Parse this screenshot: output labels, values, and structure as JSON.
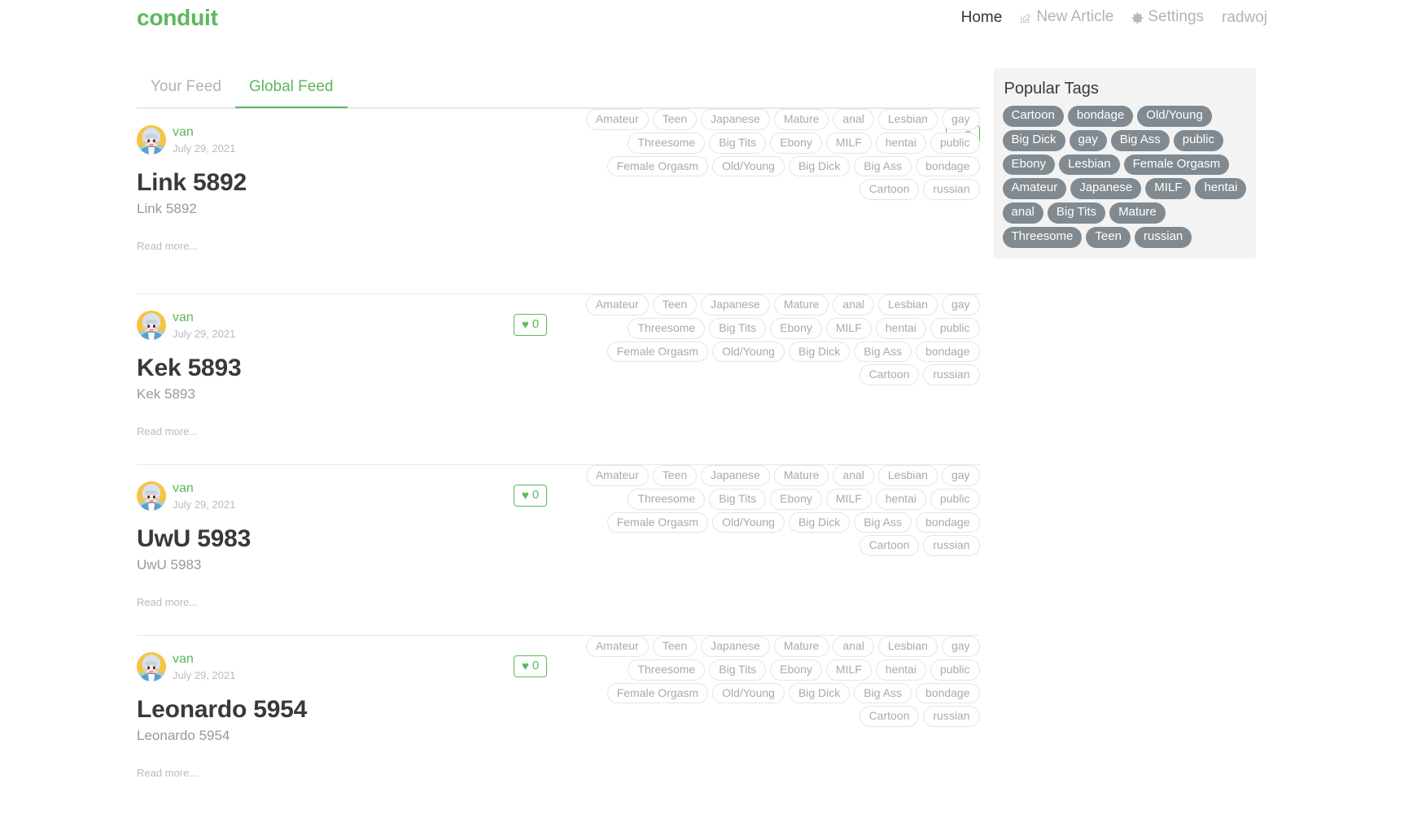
{
  "brand": "conduit",
  "nav": {
    "items": [
      {
        "label": "Home",
        "icon": null,
        "active": true
      },
      {
        "label": "New Article",
        "icon": "edit-icon",
        "active": false
      },
      {
        "label": "Settings",
        "icon": "gear-icon",
        "active": false
      },
      {
        "label": "radwoj",
        "icon": null,
        "active": false
      }
    ]
  },
  "feed_tabs": [
    {
      "label": "Your Feed",
      "active": false
    },
    {
      "label": "Global Feed",
      "active": true
    }
  ],
  "article_tags": [
    "Amateur",
    "Teen",
    "Japanese",
    "Mature",
    "anal",
    "Lesbian",
    "gay",
    "Threesome",
    "Big Tits",
    "Ebony",
    "MILF",
    "hentai",
    "public",
    "Female Orgasm",
    "Old/Young",
    "Big Dick",
    "Big Ass",
    "bondage",
    "Cartoon",
    "russian"
  ],
  "read_more": "Read more...",
  "articles": [
    {
      "author": "van",
      "date": "July 29, 2021",
      "title": "Link 5892",
      "description": "Link 5892",
      "favorites_count": "0"
    },
    {
      "author": "van",
      "date": "July 29, 2021",
      "title": "Kek 5893",
      "description": "Kek 5893",
      "favorites_count": "0"
    },
    {
      "author": "van",
      "date": "July 29, 2021",
      "title": "UwU 5983",
      "description": "UwU 5983",
      "favorites_count": "0"
    },
    {
      "author": "van",
      "date": "July 29, 2021",
      "title": "Leonardo 5954",
      "description": "Leonardo 5954",
      "favorites_count": "0"
    }
  ],
  "sidebar": {
    "title": "Popular Tags",
    "tags": [
      "Cartoon",
      "bondage",
      "Old/Young",
      "Big Dick",
      "gay",
      "Big Ass",
      "public",
      "Ebony",
      "Lesbian",
      "Female Orgasm",
      "Amateur",
      "Japanese",
      "MILF",
      "hentai",
      "anal",
      "Big Tits",
      "Mature",
      "Threesome",
      "Teen",
      "russian"
    ]
  },
  "colors": {
    "brand_green": "#5CB85C",
    "tag_pill_bg": "#818a91",
    "sidebar_bg": "#f3f3f3",
    "text_dark": "#373a3c",
    "muted": "#bbbbbb"
  },
  "icons": {
    "heart": "♥",
    "edit": "edit-icon",
    "gear": "gear-icon"
  }
}
